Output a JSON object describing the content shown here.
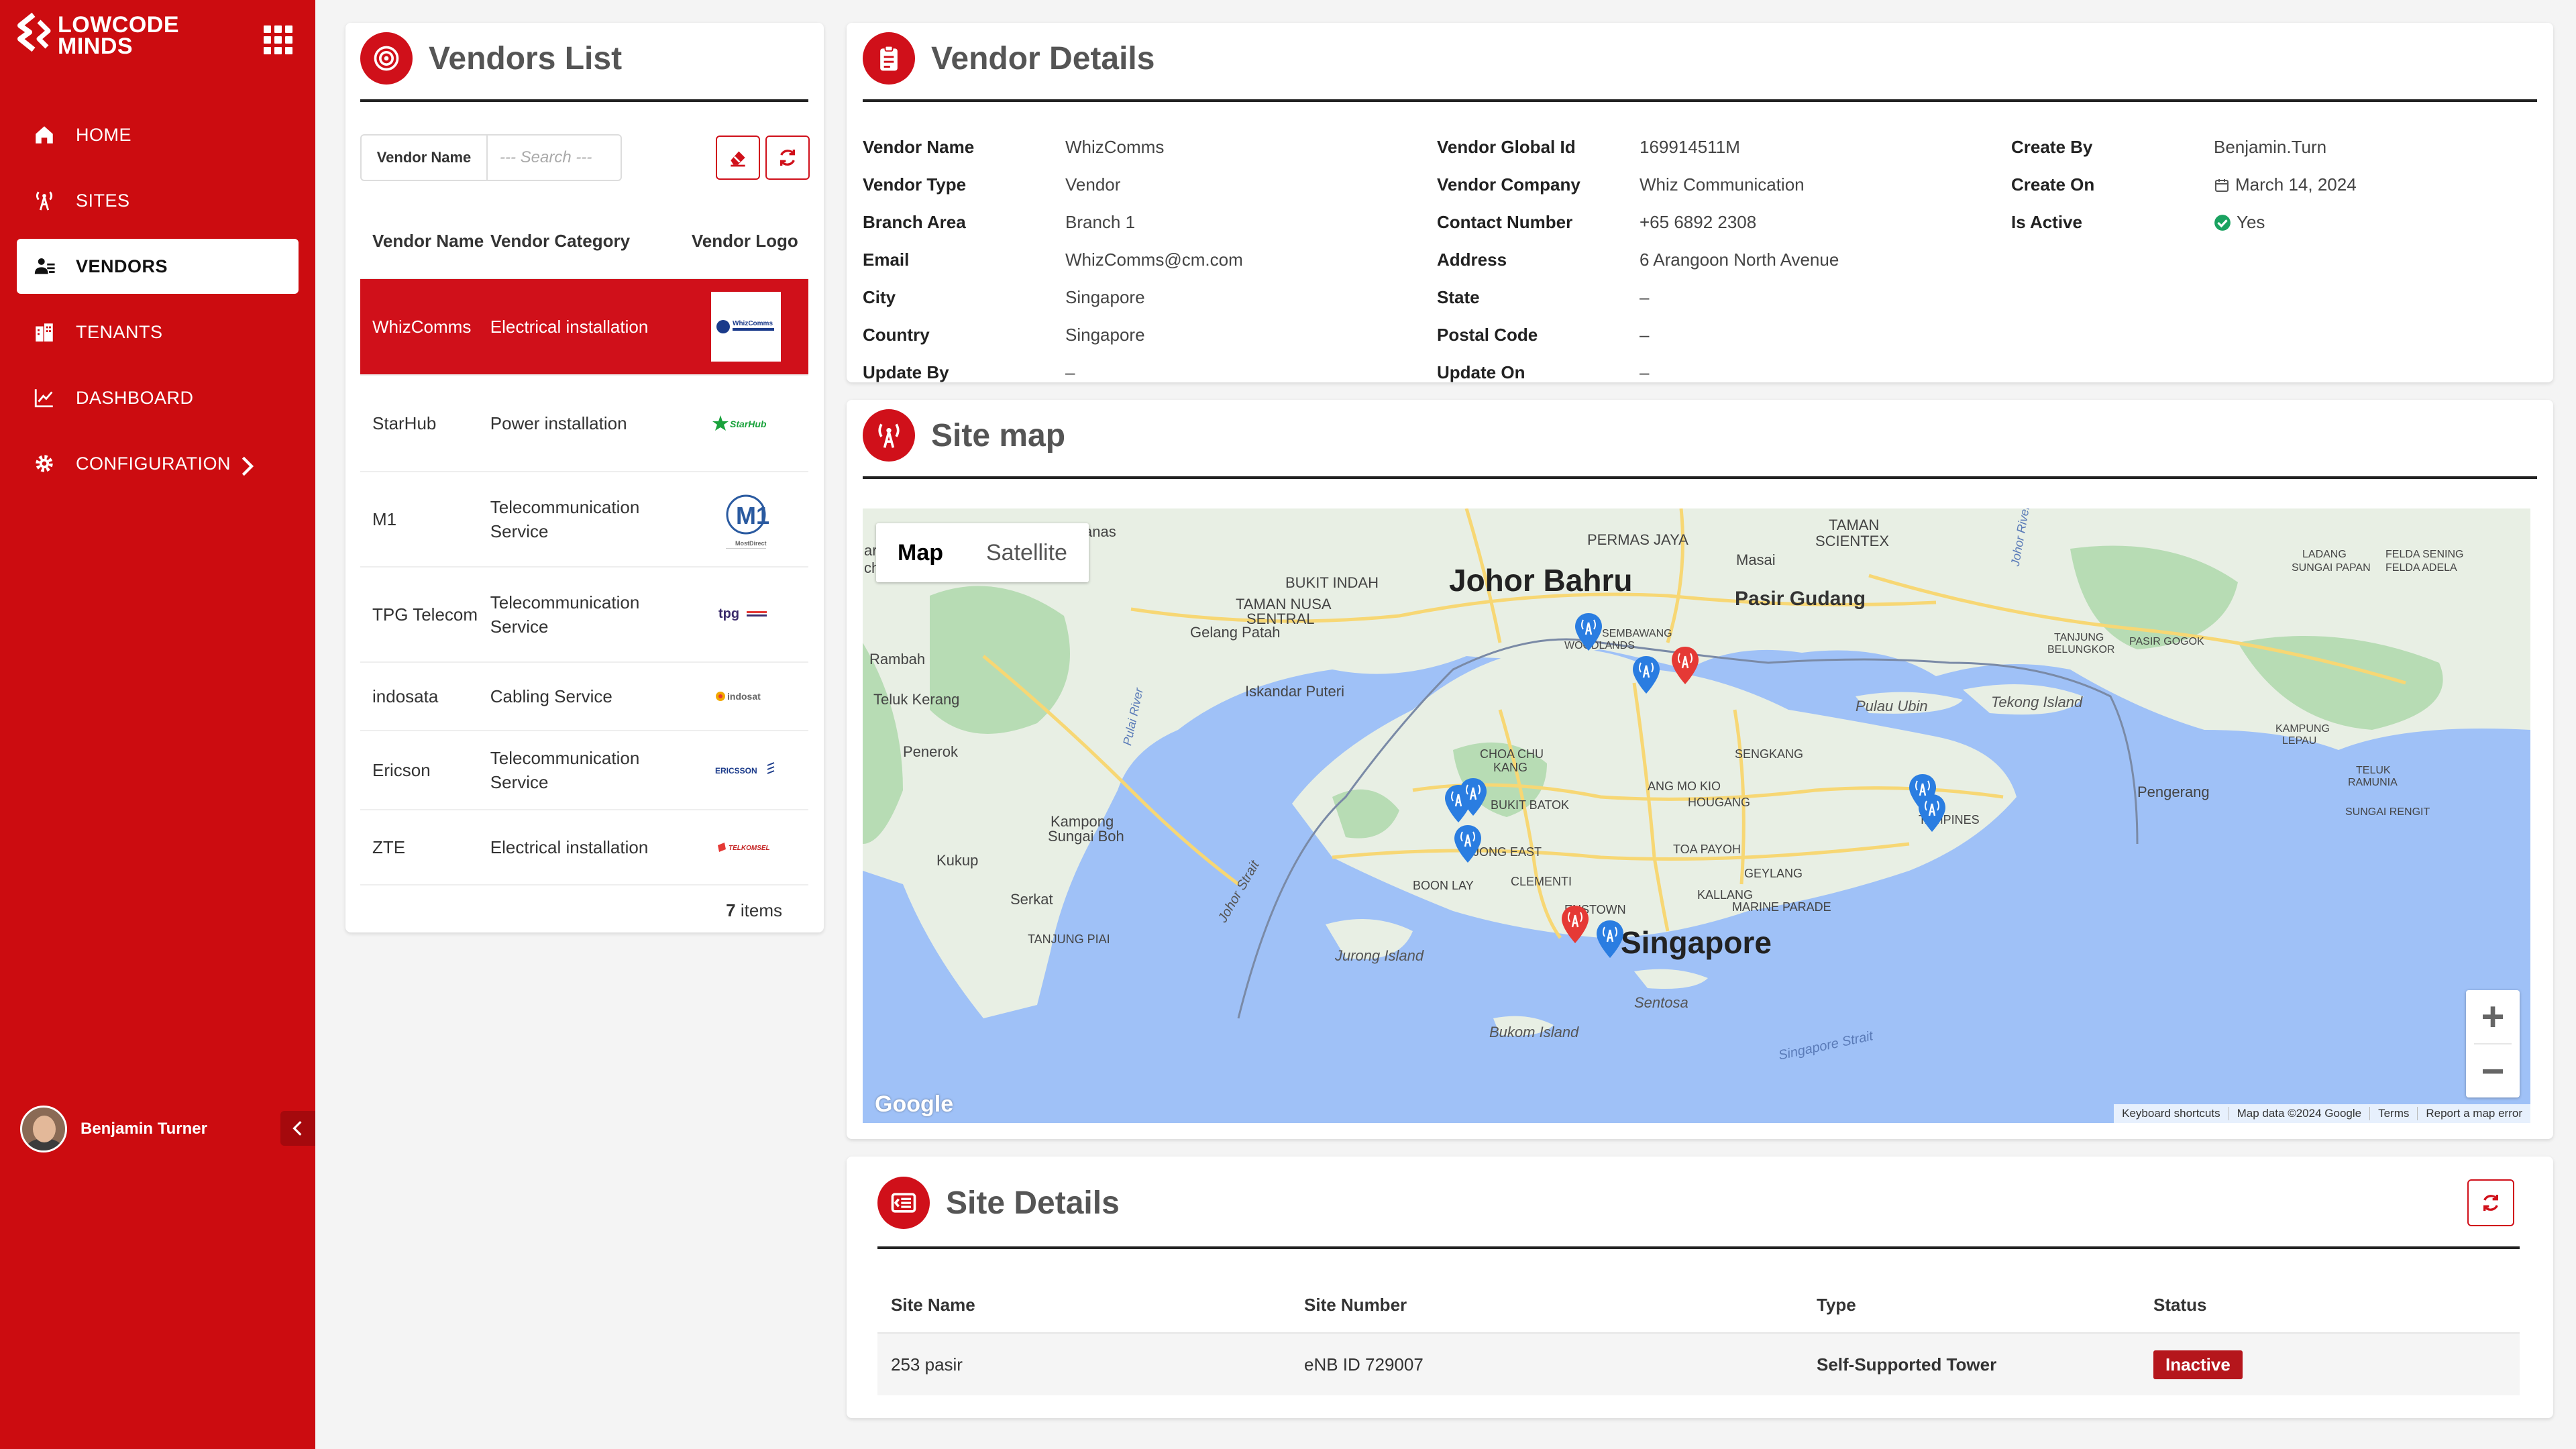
{
  "brand": {
    "line1": "LOWCODE",
    "line2": "MINDS"
  },
  "nav": [
    {
      "label": "HOME",
      "icon": "home-icon"
    },
    {
      "label": "SITES",
      "icon": "tower-icon"
    },
    {
      "label": "VENDORS",
      "icon": "vendors-icon",
      "active": true
    },
    {
      "label": "TENANTS",
      "icon": "building-icon"
    },
    {
      "label": "DASHBOARD",
      "icon": "chart-icon"
    },
    {
      "label": "CONFIGURATION",
      "icon": "gear-icon"
    }
  ],
  "user": {
    "name": "Benjamin Turner"
  },
  "vendors_list": {
    "title": "Vendors List",
    "filter_label": "Vendor Name",
    "search_placeholder": "--- Search ---",
    "headers": {
      "name": "Vendor Name",
      "category": "Vendor Category",
      "logo": "Vendor Logo"
    },
    "rows": [
      {
        "name": "WhizComms",
        "category": "Electrical installation",
        "logo_text": "WhizComms"
      },
      {
        "name": "StarHub",
        "category": "Power installation",
        "logo_text": "StarHub"
      },
      {
        "name": "M1",
        "category": "Telecommunication Service",
        "logo_text": "M1"
      },
      {
        "name": "TPG Telecom",
        "category": "Telecommunication Service",
        "logo_text": "tpg"
      },
      {
        "name": "indosata",
        "category": "Cabling Service",
        "logo_text": "indosat"
      },
      {
        "name": "Ericson",
        "category": "Telecommunication Service",
        "logo_text": "ERICSSON"
      },
      {
        "name": "ZTE",
        "category": "Electrical installation",
        "logo_text": "TELKOMSEL"
      }
    ],
    "items_count": "7",
    "items_label": "items"
  },
  "vendor_details": {
    "title": "Vendor Details",
    "col1": [
      {
        "label": "Vendor Name",
        "value": "WhizComms"
      },
      {
        "label": "Vendor Type",
        "value": "Vendor"
      },
      {
        "label": "Branch Area",
        "value": "Branch 1"
      },
      {
        "label": "Email",
        "value": "WhizComms@cm.com"
      },
      {
        "label": "City",
        "value": "Singapore"
      },
      {
        "label": "Country",
        "value": "Singapore"
      },
      {
        "label": "Update By",
        "value": "–"
      }
    ],
    "col2": [
      {
        "label": "Vendor Global Id",
        "value": "169914511M"
      },
      {
        "label": "Vendor Company",
        "value": "Whiz Communication"
      },
      {
        "label": "Contact Number",
        "value": "+65 6892 2308"
      },
      {
        "label": "Address",
        "value": "6 Arangoon North Avenue"
      },
      {
        "label": "State",
        "value": "–"
      },
      {
        "label": "Postal Code",
        "value": "–"
      },
      {
        "label": "Update On",
        "value": "–"
      }
    ],
    "col3": [
      {
        "label": "Create By",
        "value": "Benjamin.Turn"
      },
      {
        "label": "Create On",
        "value": "March 14, 2024"
      },
      {
        "label": "Is Active",
        "value": "Yes"
      }
    ]
  },
  "site_map": {
    "title": "Site map",
    "tabs": [
      "Map",
      "Satellite"
    ],
    "labels": {
      "johor": "Johor Bahru",
      "singapore": "Singapore",
      "pasir_gudang": "Pasir Gudang",
      "woodlands": "WOODLANDS",
      "sembawang": "SEMBAWANG",
      "bukit_indah": "BUKIT INDAH",
      "taman_nusa": "TAMAN NUSA",
      "sentral": "SENTRAL",
      "permas": "PERMAS JAYA",
      "taman": "TAMAN",
      "scientex": "SCIENTEX",
      "masai": "Masai",
      "gelang": "Gelang Patah",
      "iskandar": "Iskandar Puteri",
      "rambah": "Rambah",
      "teluk": "Teluk Kerang",
      "penerok": "Penerok",
      "kukup": "Kukup",
      "serkat": "Serkat",
      "tanjung_piai": "TANJUNG PIAI",
      "kampong": "Kampong",
      "sungai_boh": "Sungai Boh",
      "jurong": "Jurong Island",
      "sentosa": "Sentosa",
      "bukom": "Bukom Island",
      "pulau_ubin": "Pulau Ubin",
      "tekong": "Tekong Island",
      "pengerang": "Pengerang",
      "tampines": "TAMPINES",
      "bukit_batok": "BUKIT BATOK",
      "choa_chu": "CHOA CHU",
      "kang": "KANG",
      "ang_mo_kio": "ANG MO KIO",
      "hougang": "HOUGANG",
      "sengkang": "SENGKANG",
      "toa_payoh": "TOA PAYOH",
      "geylang": "GEYLANG",
      "kallang": "KALLANG",
      "marine": "MARINE PARADE",
      "clementi": "CLEMENTI",
      "boon_lay": "BOON LAY",
      "jong_east": "JONG EAST",
      "queenstown": "ENSTOWN",
      "johor_strait": "Johor Strait",
      "sg_strait": "Singapore Strait",
      "ladang": "LADANG",
      "sungai_papan": "SUNGAI PAPAN",
      "felda_sening": "FELDA SENING",
      "felda_adela": "FELDA ADELA",
      "tanjung": "TANJUNG",
      "belungkor": "BELUNGKOR",
      "pasir_gogok": "PASIR GOGOK",
      "kampung": "KAMPUNG",
      "lepau": "LEPAU",
      "teluk_ramunia": "TELUK",
      "ramunia": "RAMUNIA",
      "sungai_rengit": "SUNGAI RENGIT",
      "anas": "anas",
      "ar": "ar",
      "ch": "ch",
      "pulai_river": "Pulai River",
      "johor_river": "Johor River"
    },
    "google": "Google",
    "attribution": [
      "Keyboard shortcuts",
      "Map data ©2024 Google",
      "Terms",
      "Report a map error"
    ],
    "zoom_in": "+",
    "zoom_out": "−"
  },
  "site_details": {
    "title": "Site Details",
    "headers": [
      "Site Name",
      "Site Number",
      "Type",
      "Status"
    ],
    "rows": [
      {
        "name": "253 pasir",
        "number": "eNB ID 729007",
        "type": "Self-Supported Tower",
        "status": "Inactive"
      }
    ]
  },
  "colors": {
    "brand_red": "#cc0c10",
    "accent_red": "#d0101a",
    "status_inactive": "#b5161c",
    "success_green": "#1aa260",
    "map_water": "#9fc1f7",
    "map_land": "#e8efe4",
    "map_green": "#b7dcb4",
    "pin_blue": "#2a7de1",
    "pin_red": "#e53935"
  }
}
